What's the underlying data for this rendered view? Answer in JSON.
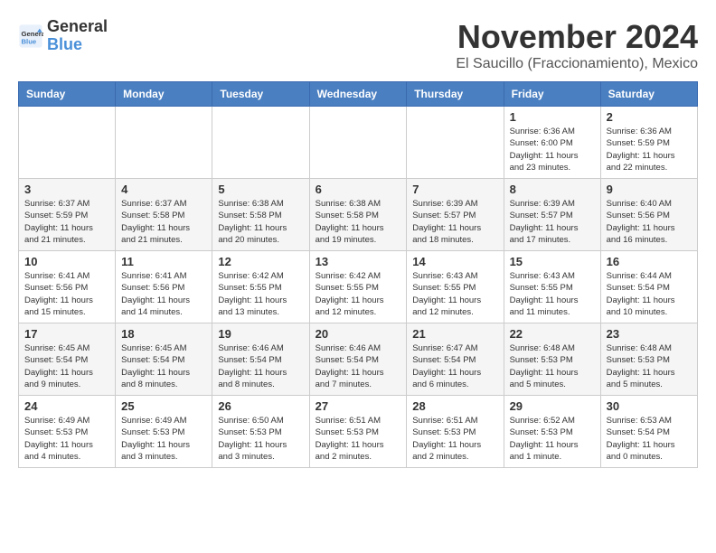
{
  "header": {
    "logo_text_general": "General",
    "logo_text_blue": "Blue",
    "month_title": "November 2024",
    "location": "El Saucillo (Fraccionamiento), Mexico"
  },
  "weekdays": [
    "Sunday",
    "Monday",
    "Tuesday",
    "Wednesday",
    "Thursday",
    "Friday",
    "Saturday"
  ],
  "weeks": [
    [
      {
        "day": "",
        "info": ""
      },
      {
        "day": "",
        "info": ""
      },
      {
        "day": "",
        "info": ""
      },
      {
        "day": "",
        "info": ""
      },
      {
        "day": "",
        "info": ""
      },
      {
        "day": "1",
        "info": "Sunrise: 6:36 AM\nSunset: 6:00 PM\nDaylight: 11 hours\nand 23 minutes."
      },
      {
        "day": "2",
        "info": "Sunrise: 6:36 AM\nSunset: 5:59 PM\nDaylight: 11 hours\nand 22 minutes."
      }
    ],
    [
      {
        "day": "3",
        "info": "Sunrise: 6:37 AM\nSunset: 5:59 PM\nDaylight: 11 hours\nand 21 minutes."
      },
      {
        "day": "4",
        "info": "Sunrise: 6:37 AM\nSunset: 5:58 PM\nDaylight: 11 hours\nand 21 minutes."
      },
      {
        "day": "5",
        "info": "Sunrise: 6:38 AM\nSunset: 5:58 PM\nDaylight: 11 hours\nand 20 minutes."
      },
      {
        "day": "6",
        "info": "Sunrise: 6:38 AM\nSunset: 5:58 PM\nDaylight: 11 hours\nand 19 minutes."
      },
      {
        "day": "7",
        "info": "Sunrise: 6:39 AM\nSunset: 5:57 PM\nDaylight: 11 hours\nand 18 minutes."
      },
      {
        "day": "8",
        "info": "Sunrise: 6:39 AM\nSunset: 5:57 PM\nDaylight: 11 hours\nand 17 minutes."
      },
      {
        "day": "9",
        "info": "Sunrise: 6:40 AM\nSunset: 5:56 PM\nDaylight: 11 hours\nand 16 minutes."
      }
    ],
    [
      {
        "day": "10",
        "info": "Sunrise: 6:41 AM\nSunset: 5:56 PM\nDaylight: 11 hours\nand 15 minutes."
      },
      {
        "day": "11",
        "info": "Sunrise: 6:41 AM\nSunset: 5:56 PM\nDaylight: 11 hours\nand 14 minutes."
      },
      {
        "day": "12",
        "info": "Sunrise: 6:42 AM\nSunset: 5:55 PM\nDaylight: 11 hours\nand 13 minutes."
      },
      {
        "day": "13",
        "info": "Sunrise: 6:42 AM\nSunset: 5:55 PM\nDaylight: 11 hours\nand 12 minutes."
      },
      {
        "day": "14",
        "info": "Sunrise: 6:43 AM\nSunset: 5:55 PM\nDaylight: 11 hours\nand 12 minutes."
      },
      {
        "day": "15",
        "info": "Sunrise: 6:43 AM\nSunset: 5:55 PM\nDaylight: 11 hours\nand 11 minutes."
      },
      {
        "day": "16",
        "info": "Sunrise: 6:44 AM\nSunset: 5:54 PM\nDaylight: 11 hours\nand 10 minutes."
      }
    ],
    [
      {
        "day": "17",
        "info": "Sunrise: 6:45 AM\nSunset: 5:54 PM\nDaylight: 11 hours\nand 9 minutes."
      },
      {
        "day": "18",
        "info": "Sunrise: 6:45 AM\nSunset: 5:54 PM\nDaylight: 11 hours\nand 8 minutes."
      },
      {
        "day": "19",
        "info": "Sunrise: 6:46 AM\nSunset: 5:54 PM\nDaylight: 11 hours\nand 8 minutes."
      },
      {
        "day": "20",
        "info": "Sunrise: 6:46 AM\nSunset: 5:54 PM\nDaylight: 11 hours\nand 7 minutes."
      },
      {
        "day": "21",
        "info": "Sunrise: 6:47 AM\nSunset: 5:54 PM\nDaylight: 11 hours\nand 6 minutes."
      },
      {
        "day": "22",
        "info": "Sunrise: 6:48 AM\nSunset: 5:53 PM\nDaylight: 11 hours\nand 5 minutes."
      },
      {
        "day": "23",
        "info": "Sunrise: 6:48 AM\nSunset: 5:53 PM\nDaylight: 11 hours\nand 5 minutes."
      }
    ],
    [
      {
        "day": "24",
        "info": "Sunrise: 6:49 AM\nSunset: 5:53 PM\nDaylight: 11 hours\nand 4 minutes."
      },
      {
        "day": "25",
        "info": "Sunrise: 6:49 AM\nSunset: 5:53 PM\nDaylight: 11 hours\nand 3 minutes."
      },
      {
        "day": "26",
        "info": "Sunrise: 6:50 AM\nSunset: 5:53 PM\nDaylight: 11 hours\nand 3 minutes."
      },
      {
        "day": "27",
        "info": "Sunrise: 6:51 AM\nSunset: 5:53 PM\nDaylight: 11 hours\nand 2 minutes."
      },
      {
        "day": "28",
        "info": "Sunrise: 6:51 AM\nSunset: 5:53 PM\nDaylight: 11 hours\nand 2 minutes."
      },
      {
        "day": "29",
        "info": "Sunrise: 6:52 AM\nSunset: 5:53 PM\nDaylight: 11 hours\nand 1 minute."
      },
      {
        "day": "30",
        "info": "Sunrise: 6:53 AM\nSunset: 5:54 PM\nDaylight: 11 hours\nand 0 minutes."
      }
    ]
  ]
}
